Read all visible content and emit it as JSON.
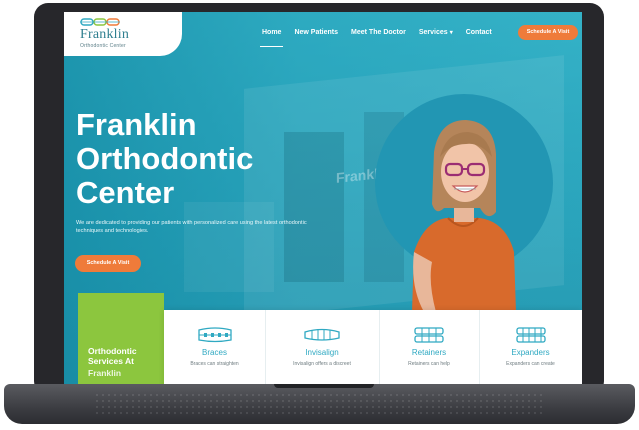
{
  "header": {
    "logo_title": "Franklin",
    "logo_subtitle": "Orthodontic Center",
    "nav": [
      {
        "label": "Home",
        "active": true
      },
      {
        "label": "New Patients"
      },
      {
        "label": "Meet The Doctor"
      },
      {
        "label": "Services",
        "has_dropdown": true
      },
      {
        "label": "Contact"
      }
    ],
    "cta_label": "Schedule A Visit"
  },
  "hero": {
    "title_lines": [
      "Franklin",
      "Orthodontic",
      "Center"
    ],
    "description": "We are dedicated to providing our patients with personalized care using the latest orthodontic techniques and technologies.",
    "cta_label": "Schedule A Visit",
    "building_sign": "Franklin"
  },
  "services": {
    "heading_lines": [
      "Orthodontic",
      "Services At"
    ],
    "heading_cut": "Franklin",
    "cards": [
      {
        "name": "Braces",
        "text": "Braces can straighten",
        "icon": "braces-icon"
      },
      {
        "name": "Invisalign",
        "text": "Invisalign offers a discreet",
        "icon": "aligner-icon"
      },
      {
        "name": "Retainers",
        "text": "Retainers can help",
        "icon": "retainer-icon"
      },
      {
        "name": "Expanders",
        "text": "Expanders can create",
        "icon": "expander-icon"
      }
    ]
  },
  "colors": {
    "brand_teal": "#2aa7bf",
    "accent_orange": "#ef7b3a",
    "accent_green": "#8cc63e",
    "laptop_frame": "#27272b"
  }
}
